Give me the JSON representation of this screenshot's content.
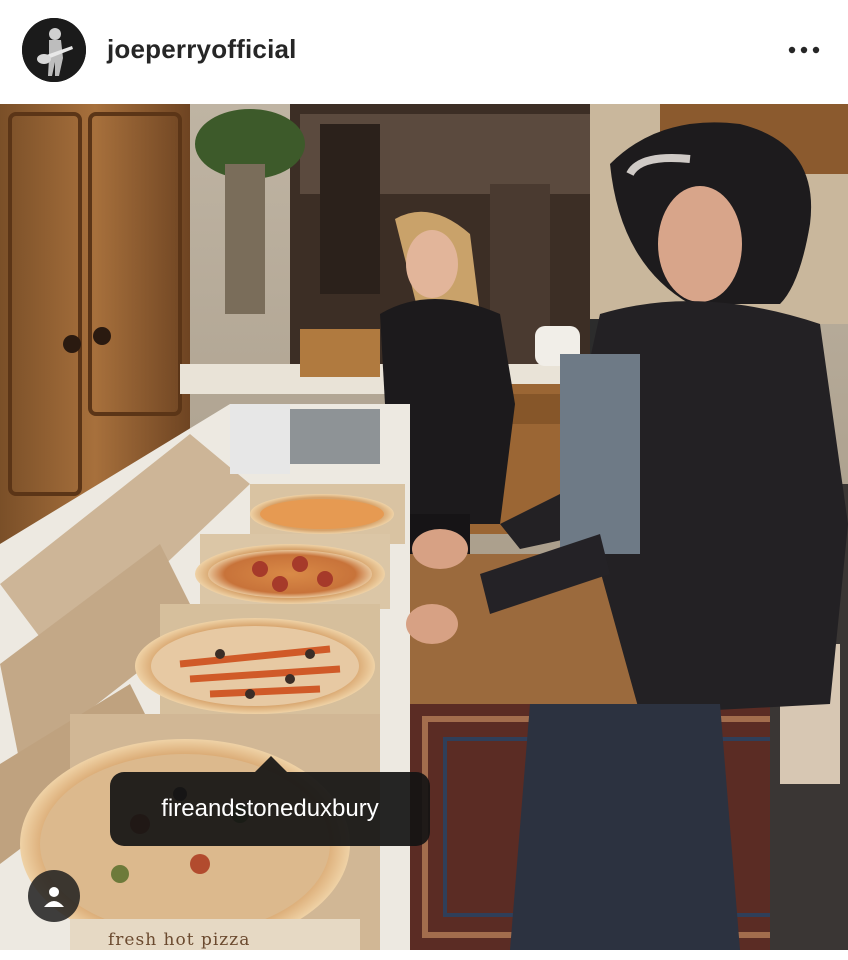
{
  "post": {
    "username": "joeperryofficial",
    "more_icon": "more-horizontal-icon",
    "avatar_icon": "profile-avatar-guitarist"
  },
  "photo": {
    "product_tag": "fireandstoneduxbury",
    "user_tag_icon": "person-icon",
    "box_print": "fresh hot pizza"
  },
  "colors": {
    "username": "#262626",
    "tag_bubble": "#141414"
  }
}
